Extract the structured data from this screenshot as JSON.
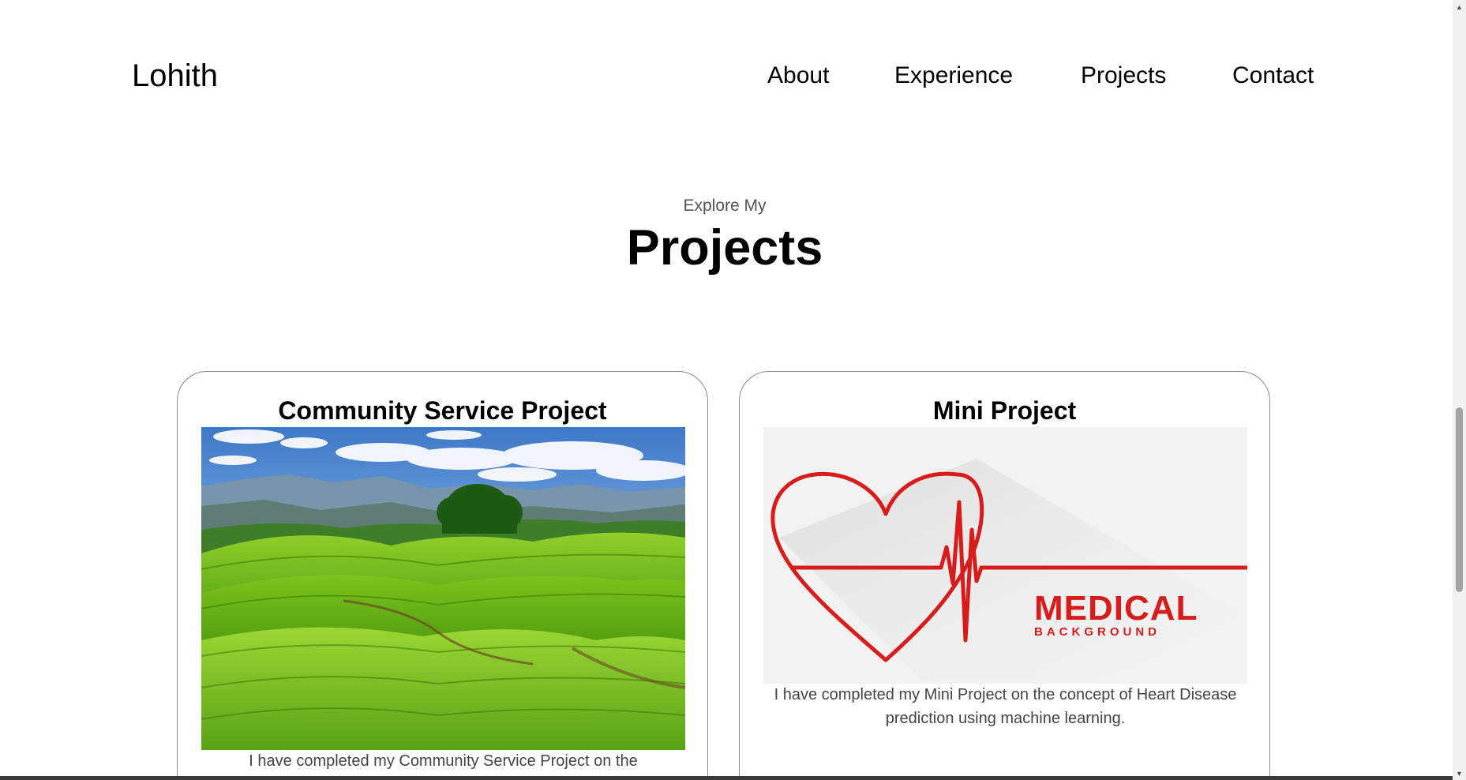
{
  "nav": {
    "logo": "Lohith",
    "links": [
      "About",
      "Experience",
      "Projects",
      "Contact"
    ]
  },
  "section": {
    "subtitle": "Explore My",
    "title": "Projects"
  },
  "projects": [
    {
      "title": "Community Service Project",
      "image": "tea-plantation-hills-landscape",
      "description": "I have completed my Community Service Project on the"
    },
    {
      "title": "Mini Project",
      "image": "medical-heart-heartbeat",
      "image_text_main": "MEDICAL",
      "image_text_sub": "BACKGROUND",
      "description": "I have completed my Mini Project on the concept of Heart Disease prediction using machine learning."
    }
  ],
  "colors": {
    "medical_red": "#d81c1c",
    "card_border": "#8a8a8a",
    "text_muted": "#555555"
  },
  "scrollbar": {
    "up_icon": "triangle-up-icon",
    "down_icon": "triangle-down-icon"
  }
}
